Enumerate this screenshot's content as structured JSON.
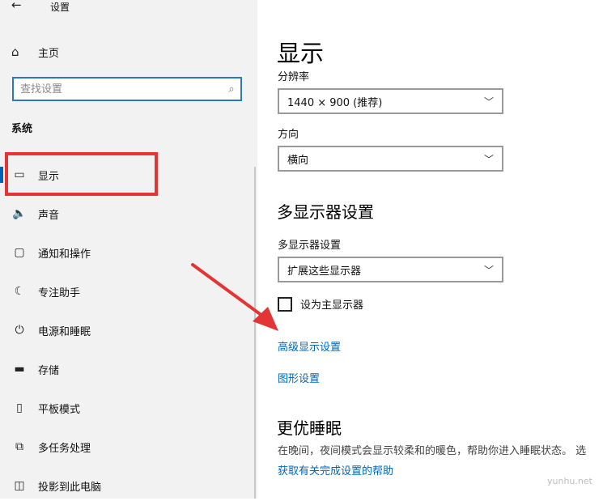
{
  "window": {
    "title": "设置"
  },
  "sidebar": {
    "home_label": "主页",
    "search_placeholder": "查找设置",
    "section_label": "系统",
    "items": [
      {
        "label": "显示",
        "icon": "monitor-icon",
        "selected": true
      },
      {
        "label": "声音",
        "icon": "speaker-icon"
      },
      {
        "label": "通知和操作",
        "icon": "notification-icon"
      },
      {
        "label": "专注助手",
        "icon": "moon-icon"
      },
      {
        "label": "电源和睡眠",
        "icon": "power-icon"
      },
      {
        "label": "存储",
        "icon": "storage-icon"
      },
      {
        "label": "平板模式",
        "icon": "tablet-icon"
      },
      {
        "label": "多任务处理",
        "icon": "multitask-icon"
      },
      {
        "label": "投影到此电脑",
        "icon": "project-icon"
      }
    ]
  },
  "main": {
    "title": "显示",
    "resolution": {
      "label": "分辨率",
      "value": "1440 × 900 (推荐)"
    },
    "orientation": {
      "label": "方向",
      "value": "横向"
    },
    "multi_display": {
      "heading": "多显示器设置",
      "label": "多显示器设置",
      "value": "扩展这些显示器",
      "checkbox_label": "设为主显示器",
      "checkbox_checked": false
    },
    "links": {
      "advanced": "高级显示设置",
      "graphics": "图形设置"
    },
    "sleep": {
      "heading": "更优睡眠",
      "description": "在晚间，夜间模式会显示较柔和的暖色，帮助你进入睡眠状态。 选",
      "link": "获取有关完成设置的帮助"
    }
  },
  "watermark": "yunhu.net",
  "colors": {
    "accent": "#0067b8",
    "annotation": "#e33535",
    "sidebar_bg": "#f2f2f2"
  }
}
